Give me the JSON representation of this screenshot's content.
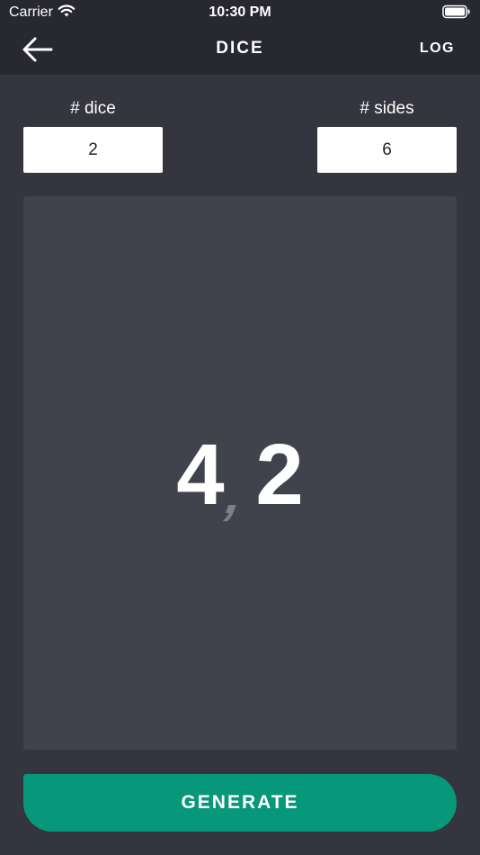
{
  "status_bar": {
    "carrier": "Carrier",
    "time": "10:30 PM",
    "wifi_icon": "wifi-icon",
    "battery_icon": "battery-icon"
  },
  "nav": {
    "back_icon": "arrow-left-icon",
    "title": "DICE",
    "log_label": "LOG"
  },
  "inputs": {
    "dice_label": "# dice",
    "dice_value": "2",
    "sides_label": "# sides",
    "sides_value": "6"
  },
  "result": {
    "first": "4",
    "separator": ",",
    "second": "2"
  },
  "generate_label": "GENERATE",
  "colors": {
    "background": "#34353e",
    "bar": "#272830",
    "panel": "#40424c",
    "accent": "#07977a",
    "separator": "#7d7f87"
  }
}
